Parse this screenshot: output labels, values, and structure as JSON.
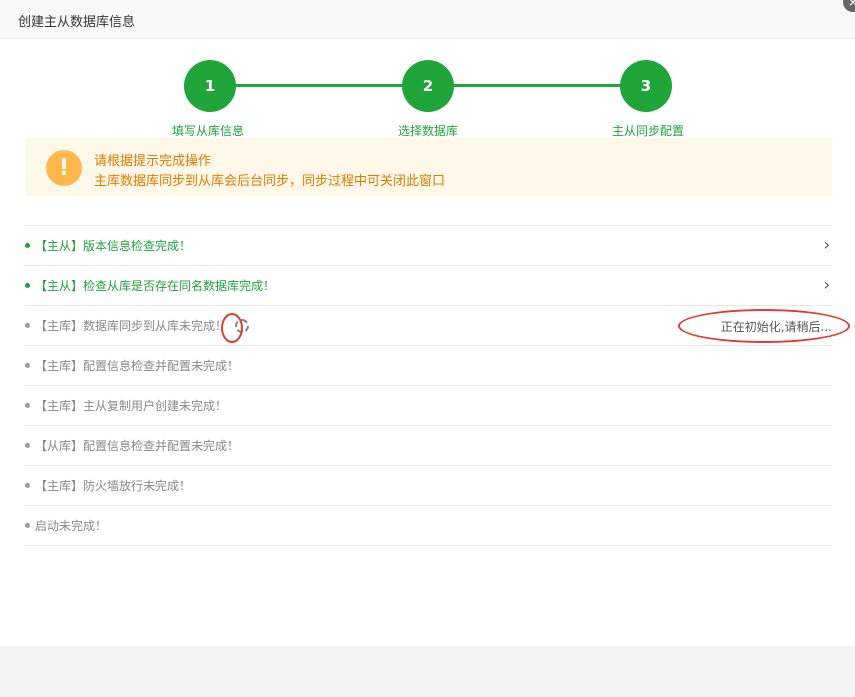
{
  "dialog": {
    "title": "创建主从数据库信息",
    "close_icon": "×"
  },
  "steps": [
    {
      "number": "1",
      "label": "填写从库信息"
    },
    {
      "number": "2",
      "label": "选择数据库"
    },
    {
      "number": "3",
      "label": "主从同步配置"
    }
  ],
  "alert": {
    "icon": "!",
    "title": "请根据提示完成操作",
    "message": "主库数据库同步到从库会后台同步，同步过程中可关闭此窗口"
  },
  "checks": [
    {
      "text": "【主从】版本信息检查完成！",
      "status": "done"
    },
    {
      "text": "【主从】检查从库是否存在同名数据库完成！",
      "status": "done"
    },
    {
      "text": "【主库】数据库同步到从库未完成！",
      "status": "loading",
      "right_status": "正在初始化,请稍后..."
    },
    {
      "text": "【主库】配置信息检查并配置未完成！",
      "status": "pending"
    },
    {
      "text": "【主库】主从复制用户创建未完成！",
      "status": "pending"
    },
    {
      "text": "【从库】配置信息检查并配置未完成！",
      "status": "pending"
    },
    {
      "text": "【主库】防火墙放行未完成！",
      "status": "pending"
    },
    {
      "text": "启动未完成！",
      "status": "pending"
    }
  ],
  "colors": {
    "accent": "#20a53a",
    "warning": "#e07b00",
    "annotation": "#e53935"
  }
}
